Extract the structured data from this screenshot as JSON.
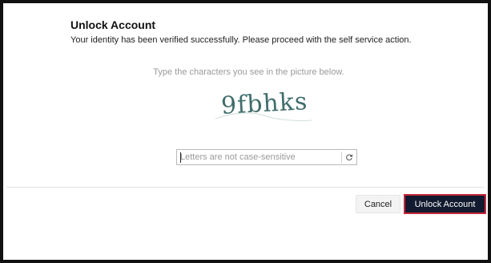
{
  "dialog": {
    "title": "Unlock Account",
    "subtitle": "Your identity has been verified successfully. Please proceed with the self service action."
  },
  "captcha": {
    "instruction": "Type the characters you see in the picture below.",
    "image_text": "9fbhks",
    "input_value": "",
    "input_placeholder": "Letters are not case-sensitive",
    "refresh_icon": "refresh-icon",
    "text_color": "#3f6d6b"
  },
  "actions": {
    "cancel_label": "Cancel",
    "unlock_label": "Unlock Account",
    "unlock_bg": "#111a2e",
    "unlock_border": "#c8273a"
  }
}
